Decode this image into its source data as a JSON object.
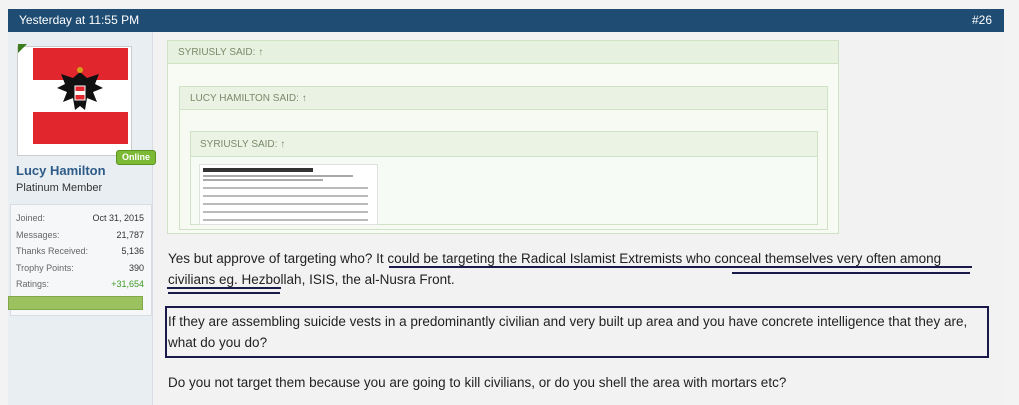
{
  "header": {
    "date": "Yesterday at 11:55 PM",
    "post_number": "#26"
  },
  "user": {
    "name": "Lucy Hamilton",
    "title": "Platinum Member",
    "online": "Online",
    "stats": [
      {
        "label": "Joined:",
        "value": "Oct 31, 2015"
      },
      {
        "label": "Messages:",
        "value": "21,787"
      },
      {
        "label": "Thanks Received:",
        "value": "5,136"
      },
      {
        "label": "Trophy Points:",
        "value": "390"
      },
      {
        "label": "Ratings:",
        "value": "+31,654"
      }
    ]
  },
  "quotes": [
    {
      "label": "SYRIUSLY SAID: ↑"
    },
    {
      "label": "LUCY HAMILTON SAID: ↑"
    },
    {
      "label": "SYRIUSLY SAID: ↑"
    }
  ],
  "post": {
    "p1": "Yes but approve of targeting who? It could be targeting the Radical Islamist Extremists who conceal themselves very often among civilians eg. Hezbollah, ISIS, the al-Nusra Front.",
    "p2": "If they are assembling suicide vests in a predominantly civilian and very built up area and you have concrete intelligence that they are, what do you do?",
    "p3": "Do you not target them because you are going to kill civilians, or do you shell the area with mortars etc?"
  },
  "colors": {
    "header": "#1f4c73",
    "online": "#7cba35",
    "username": "#2d5a87",
    "annotation": "#1a1a4a"
  }
}
